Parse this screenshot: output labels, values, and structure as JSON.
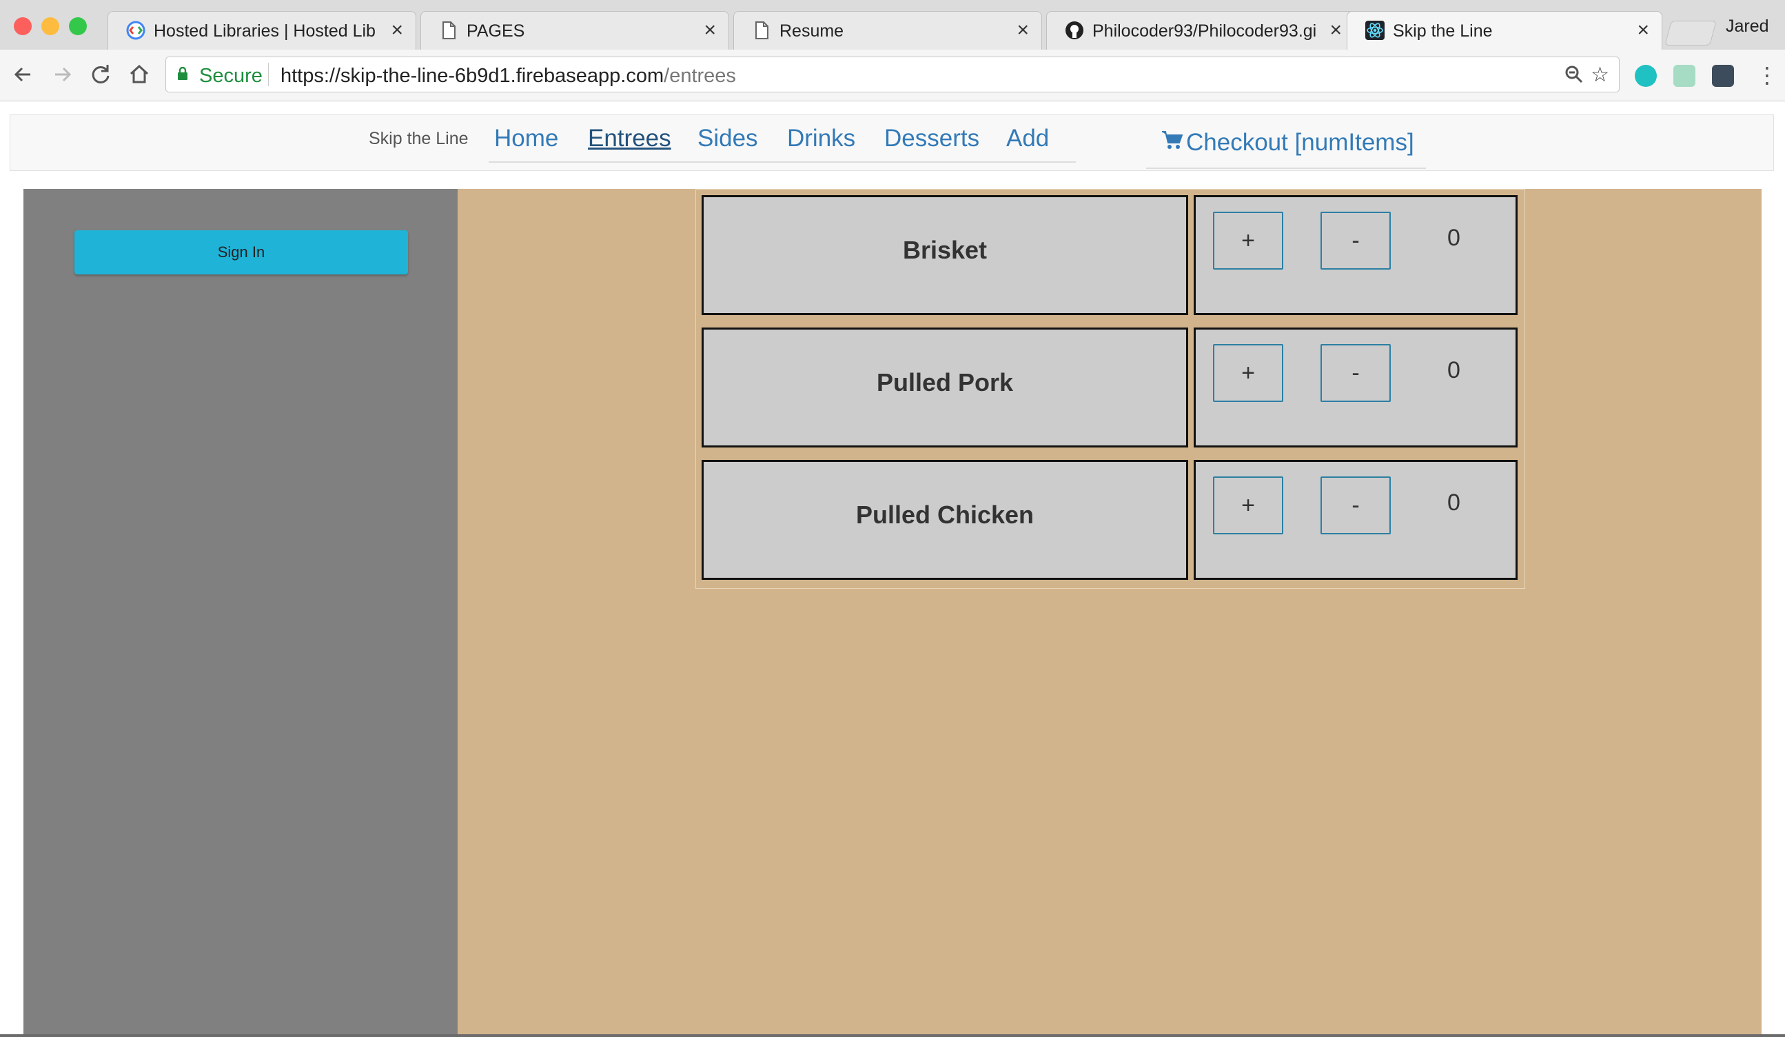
{
  "browser": {
    "tabs": [
      {
        "title": "Hosted Libraries  |  Hosted Lib",
        "icon": "google-developers-icon",
        "active": false
      },
      {
        "title": "PAGES",
        "icon": "document-icon",
        "active": false
      },
      {
        "title": "Resume",
        "icon": "document-icon",
        "active": false
      },
      {
        "title": "Philocoder93/Philocoder93.gi",
        "icon": "github-icon",
        "active": false
      },
      {
        "title": "Skip the Line",
        "icon": "react-icon",
        "active": true
      }
    ],
    "profile_name": "Jared",
    "secure_label": "Secure",
    "url_host": "https://skip-the-line-6b9d1.firebaseapp.com",
    "url_path": "/entrees",
    "secure_color": "#1e8e3e"
  },
  "navbar": {
    "brand": "Skip the Line",
    "links": [
      "Home",
      "Entrees",
      "Sides",
      "Drinks",
      "Desserts",
      "Add"
    ],
    "current": "Entrees",
    "checkout_label": "Checkout [numItems]",
    "link_color": "#337ab7"
  },
  "sidebar": {
    "signin_label": "Sign In",
    "button_color": "#1fb3d7",
    "background": "#808080"
  },
  "menu": {
    "background": "#d2b48c",
    "items": [
      {
        "name": "Brisket",
        "plus": "+",
        "minus": "-",
        "quantity": "0"
      },
      {
        "name": "Pulled Pork",
        "plus": "+",
        "minus": "-",
        "quantity": "0"
      },
      {
        "name": "Pulled Chicken",
        "plus": "+",
        "minus": "-",
        "quantity": "0"
      }
    ]
  }
}
